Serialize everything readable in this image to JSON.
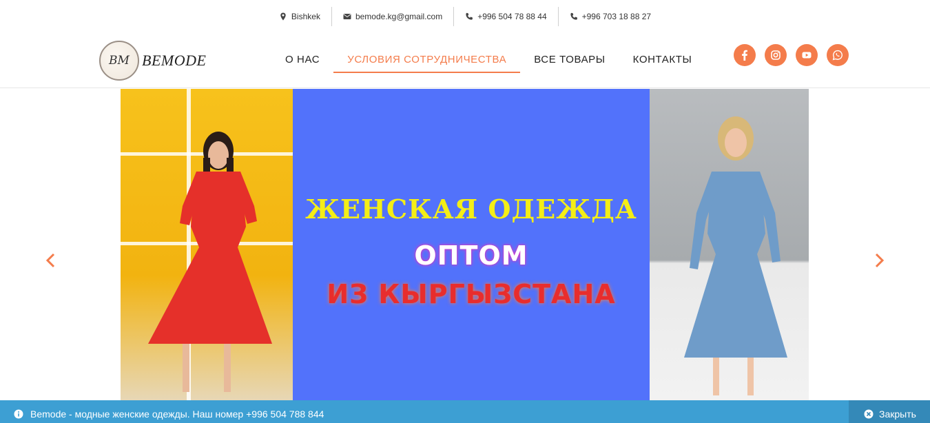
{
  "topbar": {
    "location": "Bishkek",
    "email": "bemode.kg@gmail.com",
    "phone1": "+996 504 78 88 44",
    "phone2": "+996 703 18 88 27"
  },
  "logo": {
    "monogram": "BM",
    "brand": "BEMODE"
  },
  "nav": {
    "items": [
      {
        "label": "О НАС"
      },
      {
        "label": "УСЛОВИЯ СОТРУДНИЧЕСТВА"
      },
      {
        "label": "ВСЕ ТОВАРЫ"
      },
      {
        "label": "КОНТАКТЫ"
      }
    ]
  },
  "social": [
    "facebook-icon",
    "instagram-icon",
    "youtube-icon",
    "whatsapp-icon"
  ],
  "slider": {
    "line1": "ЖЕНСКАЯ ОДЕЖДА",
    "line2": "ОПТОМ",
    "line3": "ИЗ КЫРГЫЗСТАНА"
  },
  "notice": {
    "text": "Bemode - модные женские одежды. Наш номер +996 504 788 844",
    "close_label": "Закрыть"
  },
  "colors": {
    "accent": "#f47c4b",
    "banner_blue": "#5272fb",
    "notice_bg": "#3d9fd3"
  }
}
